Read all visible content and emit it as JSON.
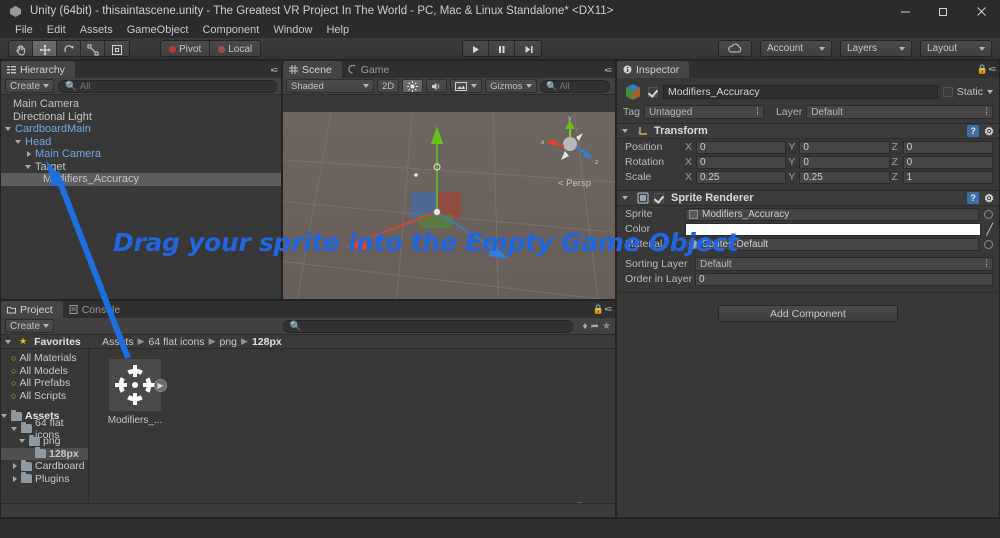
{
  "window": {
    "title": "Unity (64bit) - thisaintascene.unity - The Greatest VR Project In The World - PC, Mac & Linux Standalone* <DX11>",
    "app_icon": "unity-icon",
    "controls": {
      "minimize": "minimize-icon",
      "restore": "restore-icon",
      "close": "close-icon"
    }
  },
  "menubar": {
    "items": [
      "File",
      "Edit",
      "Assets",
      "GameObject",
      "Component",
      "Window",
      "Help"
    ]
  },
  "toolbar": {
    "transform_tools": [
      {
        "name": "hand-tool",
        "active": false
      },
      {
        "name": "move-tool",
        "active": true
      },
      {
        "name": "rotate-tool",
        "active": false
      },
      {
        "name": "scale-tool",
        "active": false
      },
      {
        "name": "rect-tool",
        "active": false
      }
    ],
    "pivot_label": "Pivot",
    "local_label": "Local",
    "play_controls": [
      "play-button",
      "pause-button",
      "step-button"
    ],
    "cloud_label": "cloud-icon",
    "account_label": "Account",
    "layers_label": "Layers",
    "layout_label": "Layout"
  },
  "hierarchy": {
    "tab": "Hierarchy",
    "create_label": "Create",
    "search_placeholder": "All",
    "items": [
      {
        "label": "Main Camera",
        "depth": 0,
        "toggle": "none",
        "prefab": false,
        "selected": false
      },
      {
        "label": "Directional Light",
        "depth": 0,
        "toggle": "none",
        "prefab": false,
        "selected": false
      },
      {
        "label": "CardboardMain",
        "depth": 0,
        "toggle": "down",
        "prefab": true,
        "selected": false
      },
      {
        "label": "Head",
        "depth": 1,
        "toggle": "down",
        "prefab": true,
        "selected": false
      },
      {
        "label": "Main Camera",
        "depth": 2,
        "toggle": "right",
        "prefab": true,
        "selected": false
      },
      {
        "label": "Target",
        "depth": 2,
        "toggle": "down",
        "prefab": false,
        "selected": false
      },
      {
        "label": "Modifiers_Accuracy",
        "depth": 3,
        "toggle": "none",
        "prefab": false,
        "selected": true
      }
    ]
  },
  "scene": {
    "tabs": [
      {
        "label": "Scene",
        "icon": "scene-icon",
        "active": true
      },
      {
        "label": "Game",
        "icon": "game-icon",
        "active": false
      }
    ],
    "shading_mode": "Shaded",
    "mode_2d": "2D",
    "lighting_toggle": "lighting-icon",
    "audio_toggle": "audio-icon",
    "effects_toggle": "effects-icon",
    "gizmos_label": "Gizmos",
    "search_placeholder": "All",
    "view_gizmo": {
      "axes": [
        "x",
        "y",
        "z"
      ],
      "projection": "Persp"
    }
  },
  "inspector": {
    "tab": "Inspector",
    "lock_icon": "lock-icon",
    "object_name": "Modifiers_Accuracy",
    "object_enabled": true,
    "static_label": "Static",
    "tag_label": "Tag",
    "tag_value": "Untagged",
    "layer_label": "Layer",
    "layer_value": "Default",
    "components": [
      {
        "name": "Transform",
        "icon": "transform-icon",
        "rows": [
          {
            "label": "Position",
            "x": "0",
            "y": "0",
            "z": "0"
          },
          {
            "label": "Rotation",
            "x": "0",
            "y": "0",
            "z": "0"
          },
          {
            "label": "Scale",
            "x": "0.25",
            "y": "0.25",
            "z": "1"
          }
        ]
      }
    ],
    "sprite_renderer": {
      "name": "Sprite Renderer",
      "enabled": true,
      "sprite_label": "Sprite",
      "sprite_value": "Modifiers_Accuracy",
      "color_label": "Color",
      "color_value": "#ffffff",
      "material_label": "Material",
      "material_value": "Sprites-Default",
      "sorting_layer_label": "Sorting Layer",
      "sorting_layer_value": "Default",
      "order_in_layer_label": "Order in Layer",
      "order_in_layer_value": "0"
    },
    "add_component_label": "Add Component"
  },
  "project": {
    "tabs": [
      {
        "label": "Project",
        "icon": "project-icon",
        "active": true
      },
      {
        "label": "Console",
        "icon": "console-icon",
        "active": false
      }
    ],
    "create_label": "Create",
    "search_placeholder": "",
    "filter_icons": [
      "filter-type-icon",
      "filter-label-icon",
      "filter-favorite-icon"
    ],
    "breadcrumb": [
      "Assets",
      "64 flat icons",
      "png",
      "128px"
    ],
    "favorites_label": "Favorites",
    "favorites": [
      "All Materials",
      "All Models",
      "All Prefabs",
      "All Scripts"
    ],
    "assets_label": "Assets",
    "tree": [
      {
        "label": "64 flat icons",
        "depth": 1,
        "toggle": "down",
        "selected": false
      },
      {
        "label": "png",
        "depth": 2,
        "toggle": "down",
        "selected": false
      },
      {
        "label": "128px",
        "depth": 3,
        "toggle": "none",
        "selected": true
      },
      {
        "label": "Cardboard",
        "depth": 1,
        "toggle": "right",
        "selected": false
      },
      {
        "label": "Plugins",
        "depth": 1,
        "toggle": "right",
        "selected": false
      }
    ],
    "assets": [
      {
        "label": "Modifiers_...",
        "icon": "crosshair-target-icon"
      }
    ]
  },
  "annotation": {
    "text": "Drag your sprite into the Empty Game Object",
    "text_color": "#1f66e0",
    "outline_color": "#ffffff",
    "arrow_color": "#1d6fe0"
  }
}
